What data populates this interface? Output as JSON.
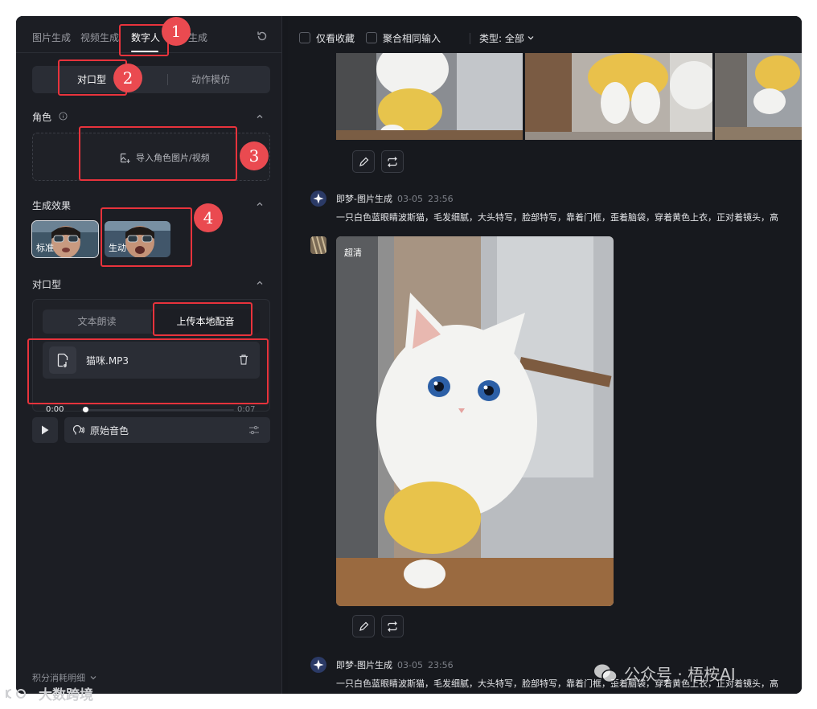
{
  "left_panel": {
    "tabs": [
      {
        "label": "图片生成"
      },
      {
        "label": "视频生成"
      },
      {
        "label": "数字人"
      },
      {
        "label": "生成"
      }
    ],
    "mode_segment": {
      "option_1": "对口型",
      "option_2": "动作模仿"
    },
    "character": {
      "title": "角色",
      "upload_label": "导入角色图片/视频"
    },
    "effect": {
      "title": "生成效果",
      "option_1": "标准",
      "option_2": "生动"
    },
    "lipsync": {
      "title": "对口型",
      "tab_1": "文本朗读",
      "tab_2": "上传本地配音",
      "file_name": "猫咪.MP3",
      "time_current": "0:00",
      "time_total": "0:07",
      "progress": 0.0
    },
    "voice": {
      "label": "原始音色"
    },
    "credits_label": "积分消耗明细"
  },
  "right_panel": {
    "filters": {
      "only_favorites": "仅看收藏",
      "merge_inputs": "聚合相同输入",
      "type_label": "类型: 全部"
    },
    "messages": [
      {
        "source": "即梦-图片生成",
        "date": "03-05",
        "time": "23:56",
        "prompt": "一只白色蓝眼睛波斯猫，毛发细腻，大头特写，脸部特写，靠着门框，歪着脑袋，穿着黄色上衣，正对着镜头，高"
      },
      {
        "source": "即梦-图片生成",
        "date": "03-05",
        "time": "23:56",
        "prompt": "一只白色蓝眼睛波斯猫，毛发细腻，大头特写，脸部特写，靠着门框，歪着脑袋，穿着黄色上衣，正对着镜头，高"
      }
    ],
    "image_badge": "超清"
  },
  "annotations": [
    "1",
    "2",
    "3",
    "4"
  ],
  "watermarks": {
    "left": "大数跨境",
    "right": "公众号 · 梧桉AI"
  },
  "colors": {
    "annotation_red": "#e8333c",
    "panel_bg": "#1c1e24",
    "content_bg": "#17191e"
  }
}
